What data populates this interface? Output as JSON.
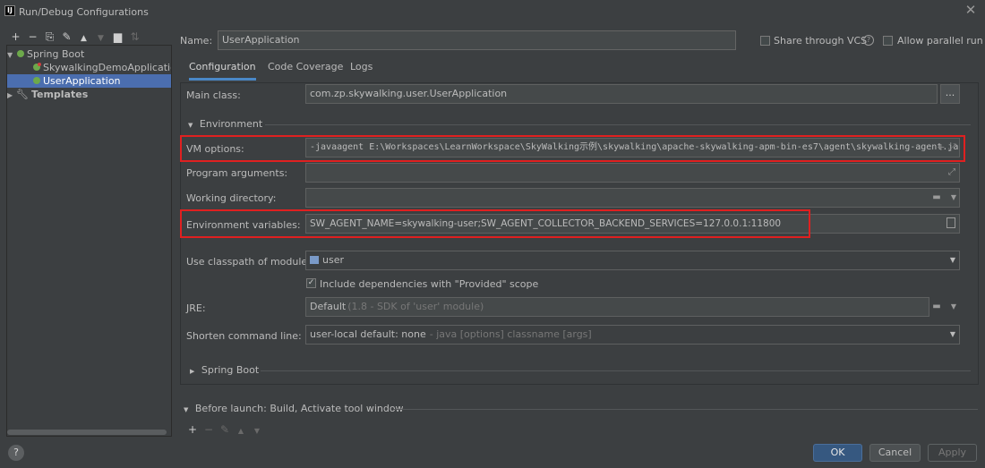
{
  "window": {
    "title": "Run/Debug Configurations",
    "app_icon": "IJ"
  },
  "left_toolbar": {
    "icons": [
      {
        "name": "add-icon",
        "glyph": "+"
      },
      {
        "name": "remove-icon",
        "glyph": "−"
      },
      {
        "name": "copy-icon",
        "glyph": "⧉"
      },
      {
        "name": "wrench-icon",
        "glyph": "🔧"
      },
      {
        "name": "move-up-icon",
        "glyph": "▲"
      },
      {
        "name": "move-down-icon",
        "glyph": "▼"
      },
      {
        "name": "folder-icon",
        "glyph": "▆"
      },
      {
        "name": "sort-icon",
        "glyph": "⇅"
      }
    ]
  },
  "tree": {
    "spring_boot": "Spring Boot",
    "items": [
      "SkywalkingDemoApplication",
      "UserApplication"
    ],
    "templates": "Templates"
  },
  "name_row": {
    "label": "Name:",
    "value": "UserApplication",
    "share_label": "Share through VCS",
    "parallel_label": "Allow parallel run"
  },
  "tabs": [
    "Configuration",
    "Code Coverage",
    "Logs"
  ],
  "form": {
    "main_class_label": "Main class:",
    "main_class_value": "com.zp.skywalking.user.UserApplication",
    "main_class_browse": "...",
    "environment_section": "Environment",
    "vm_options_label": "VM options:",
    "vm_options_value": "-javaagent E:\\Workspaces\\LearnWorkspace\\SkyWalking示例\\skywalking\\apache-skywalking-apm-bin-es7\\agent\\skywalking-agent.jar",
    "program_args_label": "Program arguments:",
    "program_args_value": "",
    "working_dir_label": "Working directory:",
    "working_dir_value": "",
    "env_vars_label": "Environment variables:",
    "env_vars_value": "SW_AGENT_NAME=skywalking-user;SW_AGENT_COLLECTOR_BACKEND_SERVICES=127.0.0.1:11800",
    "classpath_label": "Use classpath of module:",
    "classpath_value": "user",
    "include_provided_label": "Include dependencies with \"Provided\" scope",
    "include_provided_checked": true,
    "jre_label": "JRE:",
    "jre_value": "Default",
    "jre_hint": "(1.8 - SDK of 'user' module)",
    "shorten_label": "Shorten command line:",
    "shorten_value": "user-local default: none",
    "shorten_hint": "- java [options] classname [args]",
    "spring_boot_section": "Spring Boot"
  },
  "before_launch": {
    "label": "Before launch: Build, Activate tool window"
  },
  "buttons": {
    "ok": "OK",
    "cancel": "Cancel",
    "apply": "Apply",
    "help": "?"
  },
  "colors": {
    "accent": "#4b6eaf",
    "highlight_box": "#e02020",
    "background": "#3c3f41"
  }
}
